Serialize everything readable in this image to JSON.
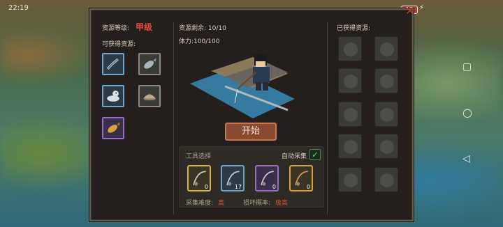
{
  "status": {
    "time": "22:19",
    "battery": "13"
  },
  "left": {
    "grade_label": "资源等级:",
    "grade_value": "甲级",
    "obtainable_label": "可获得资源:"
  },
  "center": {
    "remaining_label": "资源剩余: 10/10",
    "stamina_label": "体力:100/100",
    "start_label": "开始",
    "tool_select_label": "工具选择",
    "auto_collect_label": "自动采集",
    "tools": [
      {
        "name": "fishing-rod-yellow",
        "count": "0"
      },
      {
        "name": "fishing-rod-blue",
        "count": "17"
      },
      {
        "name": "fishing-rod-purple",
        "count": "0"
      },
      {
        "name": "fishing-rod-orange",
        "count": "0"
      }
    ],
    "difficulty_label": "采集难度:",
    "difficulty_value": "高",
    "break_label": "损坏概率:",
    "break_value": "极高"
  },
  "right": {
    "obtained_label": "已获得资源:"
  },
  "colors": {
    "accent_red": "#e04a3a",
    "rare_blue": "#6fa3c8",
    "epic_purple": "#9a6ac8",
    "legend_yellow": "#d8b040"
  }
}
